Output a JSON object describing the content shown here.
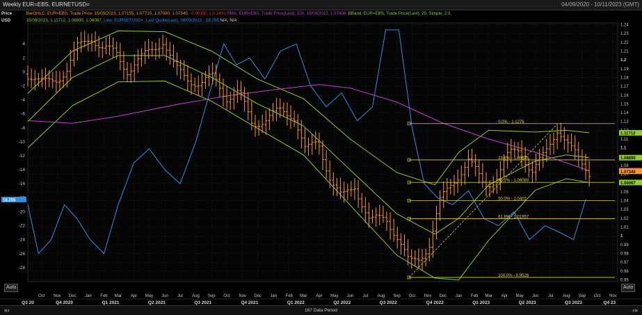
{
  "window": {
    "title": "Weekly EUR=EBS, EURNETUSD=",
    "date_range": "04/09/2020 - 10/11/2023 (GMT)"
  },
  "legend": {
    "price_label": "Price",
    "usd_label": "USD",
    "bar_series": "BarOHLC, EUR=EBS, Trade Price, 15/09/2023, 1.07155, 1.07710, 1.07080, 1.07340,",
    "bar_change": "-0.00150, (-0.14%)",
    "sma_series": "SMA, EUR=EBS, Trade Price(Last), 100, 15/09/2023, 1.07408,",
    "bband_series": "BBand, EUR=EBS, Trade Price(Last), 20, Simple, 2.0,",
    "bband_values": "15/09/2023, 1.11712, 1.08890, 1.06067,",
    "line_series": "Line, EURNETUSD=, Last Quote(Last), 08/09/2023, -18.255",
    "na": "N/A, N/A"
  },
  "controls": {
    "auto_left": "Auto",
    "auto_right": "Auto",
    "nav_left": "«‹",
    "nav_right": "›»",
    "data_period": "167 Data Period"
  },
  "colors": {
    "background": "#000000",
    "bars": "#ff9a1a",
    "sma": "#c040d0",
    "bband": "#8fcc2a",
    "line": "#2f8fe0",
    "fib": "#e0d040",
    "grid": "#3a3a3a"
  },
  "chart_data": {
    "type": "line",
    "x_range": [
      "2020-09-04",
      "2023-11-10"
    ],
    "left_axis": {
      "label": "Price USD",
      "ylim": [
        -30,
        7
      ],
      "ticks": [
        4,
        2,
        0,
        -2,
        -4,
        -6,
        -8,
        -10,
        -12,
        -14,
        -16,
        -18,
        -20,
        -22,
        -24,
        -26,
        -28
      ]
    },
    "right_axis": {
      "ylim": [
        0.948,
        1.242
      ],
      "ticks": [
        "1.24",
        "1.23",
        "1.22",
        "1.21",
        "1.2",
        "1.19",
        "1.18",
        "1.17",
        "1.16",
        "1.15",
        "1.14",
        "1.13",
        "1.12",
        "1.11",
        "1.1",
        "1.09",
        "1.08",
        "1.07",
        "1.06",
        "1.05",
        "1.04",
        "1.03",
        "1.02",
        "1.01",
        "1",
        "0.99",
        "0.98",
        "0.97",
        "0.96",
        "0.95"
      ],
      "tick_values": [
        1.24,
        1.23,
        1.22,
        1.21,
        1.2,
        1.19,
        1.18,
        1.17,
        1.16,
        1.15,
        1.14,
        1.13,
        1.12,
        1.11,
        1.1,
        1.09,
        1.08,
        1.07,
        1.06,
        1.05,
        1.04,
        1.03,
        1.02,
        1.01,
        1.0,
        0.99,
        0.98,
        0.97,
        0.96,
        0.95
      ],
      "bold_ticks": [
        "1.2",
        "1.1",
        "1"
      ]
    },
    "x_axis": {
      "months": [
        {
          "label": "Sep",
          "date": "2020-09-01"
        },
        {
          "label": "Oct",
          "date": "2020-10-01"
        },
        {
          "label": "Nov",
          "date": "2020-11-01"
        },
        {
          "label": "Dec",
          "date": "2020-12-01"
        },
        {
          "label": "Jan",
          "date": "2021-01-01"
        },
        {
          "label": "Feb",
          "date": "2021-02-01"
        },
        {
          "label": "Mar",
          "date": "2021-03-01"
        },
        {
          "label": "Apr",
          "date": "2021-04-01"
        },
        {
          "label": "May",
          "date": "2021-05-01"
        },
        {
          "label": "Jun",
          "date": "2021-06-01"
        },
        {
          "label": "Jul",
          "date": "2021-07-01"
        },
        {
          "label": "Aug",
          "date": "2021-08-01"
        },
        {
          "label": "Sep",
          "date": "2021-09-01"
        },
        {
          "label": "Oct",
          "date": "2021-10-01"
        },
        {
          "label": "Nov",
          "date": "2021-11-01"
        },
        {
          "label": "Dec",
          "date": "2021-12-01"
        },
        {
          "label": "Jan",
          "date": "2022-01-01"
        },
        {
          "label": "Feb",
          "date": "2022-02-01"
        },
        {
          "label": "Mar",
          "date": "2022-03-01"
        },
        {
          "label": "Apr",
          "date": "2022-04-01"
        },
        {
          "label": "May",
          "date": "2022-05-01"
        },
        {
          "label": "Jun",
          "date": "2022-06-01"
        },
        {
          "label": "Jul",
          "date": "2022-07-01"
        },
        {
          "label": "Aug",
          "date": "2022-08-01"
        },
        {
          "label": "Sep",
          "date": "2022-09-01"
        },
        {
          "label": "Oct",
          "date": "2022-10-01"
        },
        {
          "label": "Nov",
          "date": "2022-11-01"
        },
        {
          "label": "Dec",
          "date": "2022-12-01"
        },
        {
          "label": "Jan",
          "date": "2023-01-01"
        },
        {
          "label": "Feb",
          "date": "2023-02-01"
        },
        {
          "label": "Mar",
          "date": "2023-03-01"
        },
        {
          "label": "Apr",
          "date": "2023-04-01"
        },
        {
          "label": "May",
          "date": "2023-05-01"
        },
        {
          "label": "Jun",
          "date": "2023-06-01"
        },
        {
          "label": "Jul",
          "date": "2023-07-01"
        },
        {
          "label": "Aug",
          "date": "2023-08-01"
        },
        {
          "label": "Sep",
          "date": "2023-09-01"
        },
        {
          "label": "Oct",
          "date": "2023-10-01"
        },
        {
          "label": "Nov",
          "date": "2023-11-01"
        }
      ],
      "quarters": [
        {
          "label": "Q3 20",
          "date": "2020-09-04"
        },
        {
          "label": "Q4 2020",
          "date": "2020-11-15"
        },
        {
          "label": "Q1 2021",
          "date": "2021-02-14"
        },
        {
          "label": "Q2 2021",
          "date": "2021-05-16"
        },
        {
          "label": "Q3 2021",
          "date": "2021-08-15"
        },
        {
          "label": "Q4 2021",
          "date": "2021-11-15"
        },
        {
          "label": "Q1 2022",
          "date": "2022-02-14"
        },
        {
          "label": "Q2 2022",
          "date": "2022-05-16"
        },
        {
          "label": "Q3 2022",
          "date": "2022-08-15"
        },
        {
          "label": "Q4 2022",
          "date": "2022-11-15"
        },
        {
          "label": "Q1 2023",
          "date": "2023-02-14"
        },
        {
          "label": "Q2 2023",
          "date": "2023-05-16"
        },
        {
          "label": "Q3 2023",
          "date": "2023-08-15"
        },
        {
          "label": "Q4 23",
          "date": "2023-10-25"
        }
      ]
    },
    "bars_close": [
      {
        "date": "2020-09-04",
        "close": 1.184
      },
      {
        "date": "2020-10-01",
        "close": 1.172
      },
      {
        "date": "2020-11-01",
        "close": 1.18
      },
      {
        "date": "2020-11-20",
        "close": 1.188
      },
      {
        "date": "2020-12-10",
        "close": 1.213
      },
      {
        "date": "2021-01-06",
        "close": 1.228
      },
      {
        "date": "2021-01-28",
        "close": 1.212
      },
      {
        "date": "2021-02-25",
        "close": 1.208
      },
      {
        "date": "2021-03-20",
        "close": 1.188
      },
      {
        "date": "2021-04-10",
        "close": 1.198
      },
      {
        "date": "2021-05-10",
        "close": 1.215
      },
      {
        "date": "2021-05-28",
        "close": 1.222
      },
      {
        "date": "2021-06-20",
        "close": 1.19
      },
      {
        "date": "2021-07-15",
        "close": 1.18
      },
      {
        "date": "2021-08-10",
        "close": 1.172
      },
      {
        "date": "2021-09-05",
        "close": 1.181
      },
      {
        "date": "2021-10-01",
        "close": 1.158
      },
      {
        "date": "2021-10-25",
        "close": 1.162
      },
      {
        "date": "2021-11-20",
        "close": 1.128
      },
      {
        "date": "2021-12-20",
        "close": 1.133
      },
      {
        "date": "2022-01-15",
        "close": 1.142
      },
      {
        "date": "2022-02-10",
        "close": 1.138
      },
      {
        "date": "2022-03-05",
        "close": 1.095
      },
      {
        "date": "2022-03-30",
        "close": 1.108
      },
      {
        "date": "2022-04-25",
        "close": 1.062
      },
      {
        "date": "2022-05-15",
        "close": 1.042
      },
      {
        "date": "2022-06-10",
        "close": 1.058
      },
      {
        "date": "2022-07-10",
        "close": 1.015
      },
      {
        "date": "2022-08-10",
        "close": 1.022
      },
      {
        "date": "2022-09-01",
        "close": 1.0
      },
      {
        "date": "2022-09-25",
        "close": 0.968
      },
      {
        "date": "2022-10-15",
        "close": 0.975
      },
      {
        "date": "2022-11-05",
        "close": 0.992
      },
      {
        "date": "2022-11-25",
        "close": 1.038
      },
      {
        "date": "2022-12-20",
        "close": 1.062
      },
      {
        "date": "2023-01-20",
        "close": 1.085
      },
      {
        "date": "2023-02-20",
        "close": 1.058
      },
      {
        "date": "2023-03-15",
        "close": 1.065
      },
      {
        "date": "2023-04-10",
        "close": 1.092
      },
      {
        "date": "2023-05-01",
        "close": 1.1
      },
      {
        "date": "2023-05-25",
        "close": 1.072
      },
      {
        "date": "2023-06-20",
        "close": 1.092
      },
      {
        "date": "2023-07-15",
        "close": 1.124
      },
      {
        "date": "2023-08-10",
        "close": 1.098
      },
      {
        "date": "2023-08-30",
        "close": 1.082
      },
      {
        "date": "2023-09-15",
        "close": 1.0734
      }
    ],
    "sma": {
      "name": "SMA 100",
      "points": [
        {
          "date": "2020-09-04",
          "v": 1.131
        },
        {
          "date": "2020-12-01",
          "v": 1.128
        },
        {
          "date": "2021-03-01",
          "v": 1.136
        },
        {
          "date": "2021-07-01",
          "v": 1.15
        },
        {
          "date": "2021-10-01",
          "v": 1.159
        },
        {
          "date": "2022-01-01",
          "v": 1.166
        },
        {
          "date": "2022-04-01",
          "v": 1.172
        },
        {
          "date": "2022-06-01",
          "v": 1.168
        },
        {
          "date": "2022-09-01",
          "v": 1.152
        },
        {
          "date": "2022-12-01",
          "v": 1.128
        },
        {
          "date": "2023-03-01",
          "v": 1.11
        },
        {
          "date": "2023-06-01",
          "v": 1.095
        },
        {
          "date": "2023-09-15",
          "v": 1.07408
        }
      ]
    },
    "bband": {
      "name": "BBand 20",
      "upper": [
        {
          "date": "2020-09-04",
          "v": 1.162
        },
        {
          "date": "2020-12-01",
          "v": 1.21
        },
        {
          "date": "2021-03-01",
          "v": 1.233
        },
        {
          "date": "2021-06-01",
          "v": 1.232
        },
        {
          "date": "2021-09-01",
          "v": 1.21
        },
        {
          "date": "2021-12-01",
          "v": 1.178
        },
        {
          "date": "2022-03-01",
          "v": 1.156
        },
        {
          "date": "2022-06-01",
          "v": 1.11
        },
        {
          "date": "2022-09-01",
          "v": 1.072
        },
        {
          "date": "2022-11-15",
          "v": 1.058
        },
        {
          "date": "2023-01-01",
          "v": 1.095
        },
        {
          "date": "2023-03-01",
          "v": 1.12
        },
        {
          "date": "2023-06-01",
          "v": 1.118
        },
        {
          "date": "2023-08-01",
          "v": 1.12
        },
        {
          "date": "2023-09-15",
          "v": 1.11712
        }
      ],
      "middle": [
        {
          "date": "2020-09-04",
          "v": 1.13
        },
        {
          "date": "2020-12-01",
          "v": 1.18
        },
        {
          "date": "2021-03-01",
          "v": 1.205
        },
        {
          "date": "2021-06-01",
          "v": 1.205
        },
        {
          "date": "2021-09-01",
          "v": 1.18
        },
        {
          "date": "2021-12-01",
          "v": 1.15
        },
        {
          "date": "2022-03-01",
          "v": 1.125
        },
        {
          "date": "2022-06-01",
          "v": 1.075
        },
        {
          "date": "2022-09-01",
          "v": 1.025
        },
        {
          "date": "2022-11-15",
          "v": 1.002
        },
        {
          "date": "2023-01-01",
          "v": 1.02
        },
        {
          "date": "2023-03-01",
          "v": 1.058
        },
        {
          "date": "2023-06-01",
          "v": 1.085
        },
        {
          "date": "2023-08-01",
          "v": 1.092
        },
        {
          "date": "2023-09-15",
          "v": 1.0889
        }
      ],
      "lower": [
        {
          "date": "2020-09-04",
          "v": 1.1
        },
        {
          "date": "2020-12-01",
          "v": 1.148
        },
        {
          "date": "2021-03-01",
          "v": 1.175
        },
        {
          "date": "2021-06-01",
          "v": 1.176
        },
        {
          "date": "2021-09-01",
          "v": 1.153
        },
        {
          "date": "2021-12-01",
          "v": 1.122
        },
        {
          "date": "2022-03-01",
          "v": 1.092
        },
        {
          "date": "2022-06-01",
          "v": 1.035
        },
        {
          "date": "2022-09-01",
          "v": 0.978
        },
        {
          "date": "2022-11-15",
          "v": 0.952
        },
        {
          "date": "2023-01-01",
          "v": 0.95
        },
        {
          "date": "2023-03-01",
          "v": 0.995
        },
        {
          "date": "2023-06-01",
          "v": 1.052
        },
        {
          "date": "2023-08-01",
          "v": 1.065
        },
        {
          "date": "2023-09-15",
          "v": 1.06067
        }
      ]
    },
    "line": {
      "name": "EURNETUSD=",
      "points": [
        {
          "date": "2020-09-04",
          "v": -19
        },
        {
          "date": "2020-09-25",
          "v": -26
        },
        {
          "date": "2020-10-20",
          "v": -24
        },
        {
          "date": "2020-11-15",
          "v": -19
        },
        {
          "date": "2020-12-10",
          "v": -21
        },
        {
          "date": "2021-01-05",
          "v": -24
        },
        {
          "date": "2021-02-01",
          "v": -26
        },
        {
          "date": "2021-03-01",
          "v": -19
        },
        {
          "date": "2021-04-01",
          "v": -13
        },
        {
          "date": "2021-05-01",
          "v": -11
        },
        {
          "date": "2021-06-01",
          "v": -14
        },
        {
          "date": "2021-07-01",
          "v": -16
        },
        {
          "date": "2021-08-01",
          "v": -10
        },
        {
          "date": "2021-09-01",
          "v": -2
        },
        {
          "date": "2021-09-25",
          "v": 4
        },
        {
          "date": "2021-10-20",
          "v": 1
        },
        {
          "date": "2021-11-15",
          "v": 2
        },
        {
          "date": "2021-12-15",
          "v": -1
        },
        {
          "date": "2022-01-15",
          "v": 3
        },
        {
          "date": "2022-02-15",
          "v": 4
        },
        {
          "date": "2022-03-15",
          "v": -2
        },
        {
          "date": "2022-04-15",
          "v": -5
        },
        {
          "date": "2022-05-15",
          "v": -3
        },
        {
          "date": "2022-06-15",
          "v": -7
        },
        {
          "date": "2022-07-15",
          "v": -5
        },
        {
          "date": "2022-08-10",
          "v": 6
        },
        {
          "date": "2022-09-05",
          "v": 6
        },
        {
          "date": "2022-10-01",
          "v": -8
        },
        {
          "date": "2022-10-25",
          "v": -16
        },
        {
          "date": "2022-11-20",
          "v": -18
        },
        {
          "date": "2022-12-20",
          "v": -19
        },
        {
          "date": "2023-01-20",
          "v": -17
        },
        {
          "date": "2023-02-20",
          "v": -21
        },
        {
          "date": "2023-03-20",
          "v": -22
        },
        {
          "date": "2023-04-20",
          "v": -20
        },
        {
          "date": "2023-05-20",
          "v": -24
        },
        {
          "date": "2023-06-20",
          "v": -22
        },
        {
          "date": "2023-07-20",
          "v": -23
        },
        {
          "date": "2023-08-15",
          "v": -24
        },
        {
          "date": "2023-09-08",
          "v": -18.255
        }
      ]
    },
    "fibonacci": {
      "start_date": "2022-09-25",
      "end_date": "2023-11-05",
      "levels": [
        {
          "label": "0.0% - 1.1276",
          "v": 1.1276
        },
        {
          "label": "23.6% - 1.08635",
          "v": 1.08635
        },
        {
          "label": "38.2% - 1.06083",
          "v": 1.06083
        },
        {
          "label": "50.0% - 1.0402",
          "v": 1.0402
        },
        {
          "label": "61.8% - 1.01957",
          "v": 1.01957
        },
        {
          "label": "100.0% - 0.9528",
          "v": 0.9528
        }
      ],
      "trend_from": {
        "date": "2022-09-25",
        "v": 0.9528
      },
      "trend_to": {
        "date": "2023-07-15",
        "v": 1.1276
      }
    },
    "value_tags": [
      {
        "text": "18.255",
        "axis": "left",
        "v": -18.255,
        "color": "#2f8fe0"
      },
      {
        "text": "1.11712",
        "axis": "right",
        "v": 1.11712,
        "color": "#8fcc2a"
      },
      {
        "text": "1.08890",
        "axis": "right",
        "v": 1.0889,
        "color": "#8fcc2a"
      },
      {
        "text": "1.07408",
        "axis": "right",
        "v": 1.07408,
        "color": "#c040d0"
      },
      {
        "text": "1.07340",
        "axis": "right",
        "v": 1.0734,
        "color": "#ff9a1a"
      },
      {
        "text": "1.06067",
        "axis": "right",
        "v": 1.06067,
        "color": "#8fcc2a"
      }
    ]
  }
}
